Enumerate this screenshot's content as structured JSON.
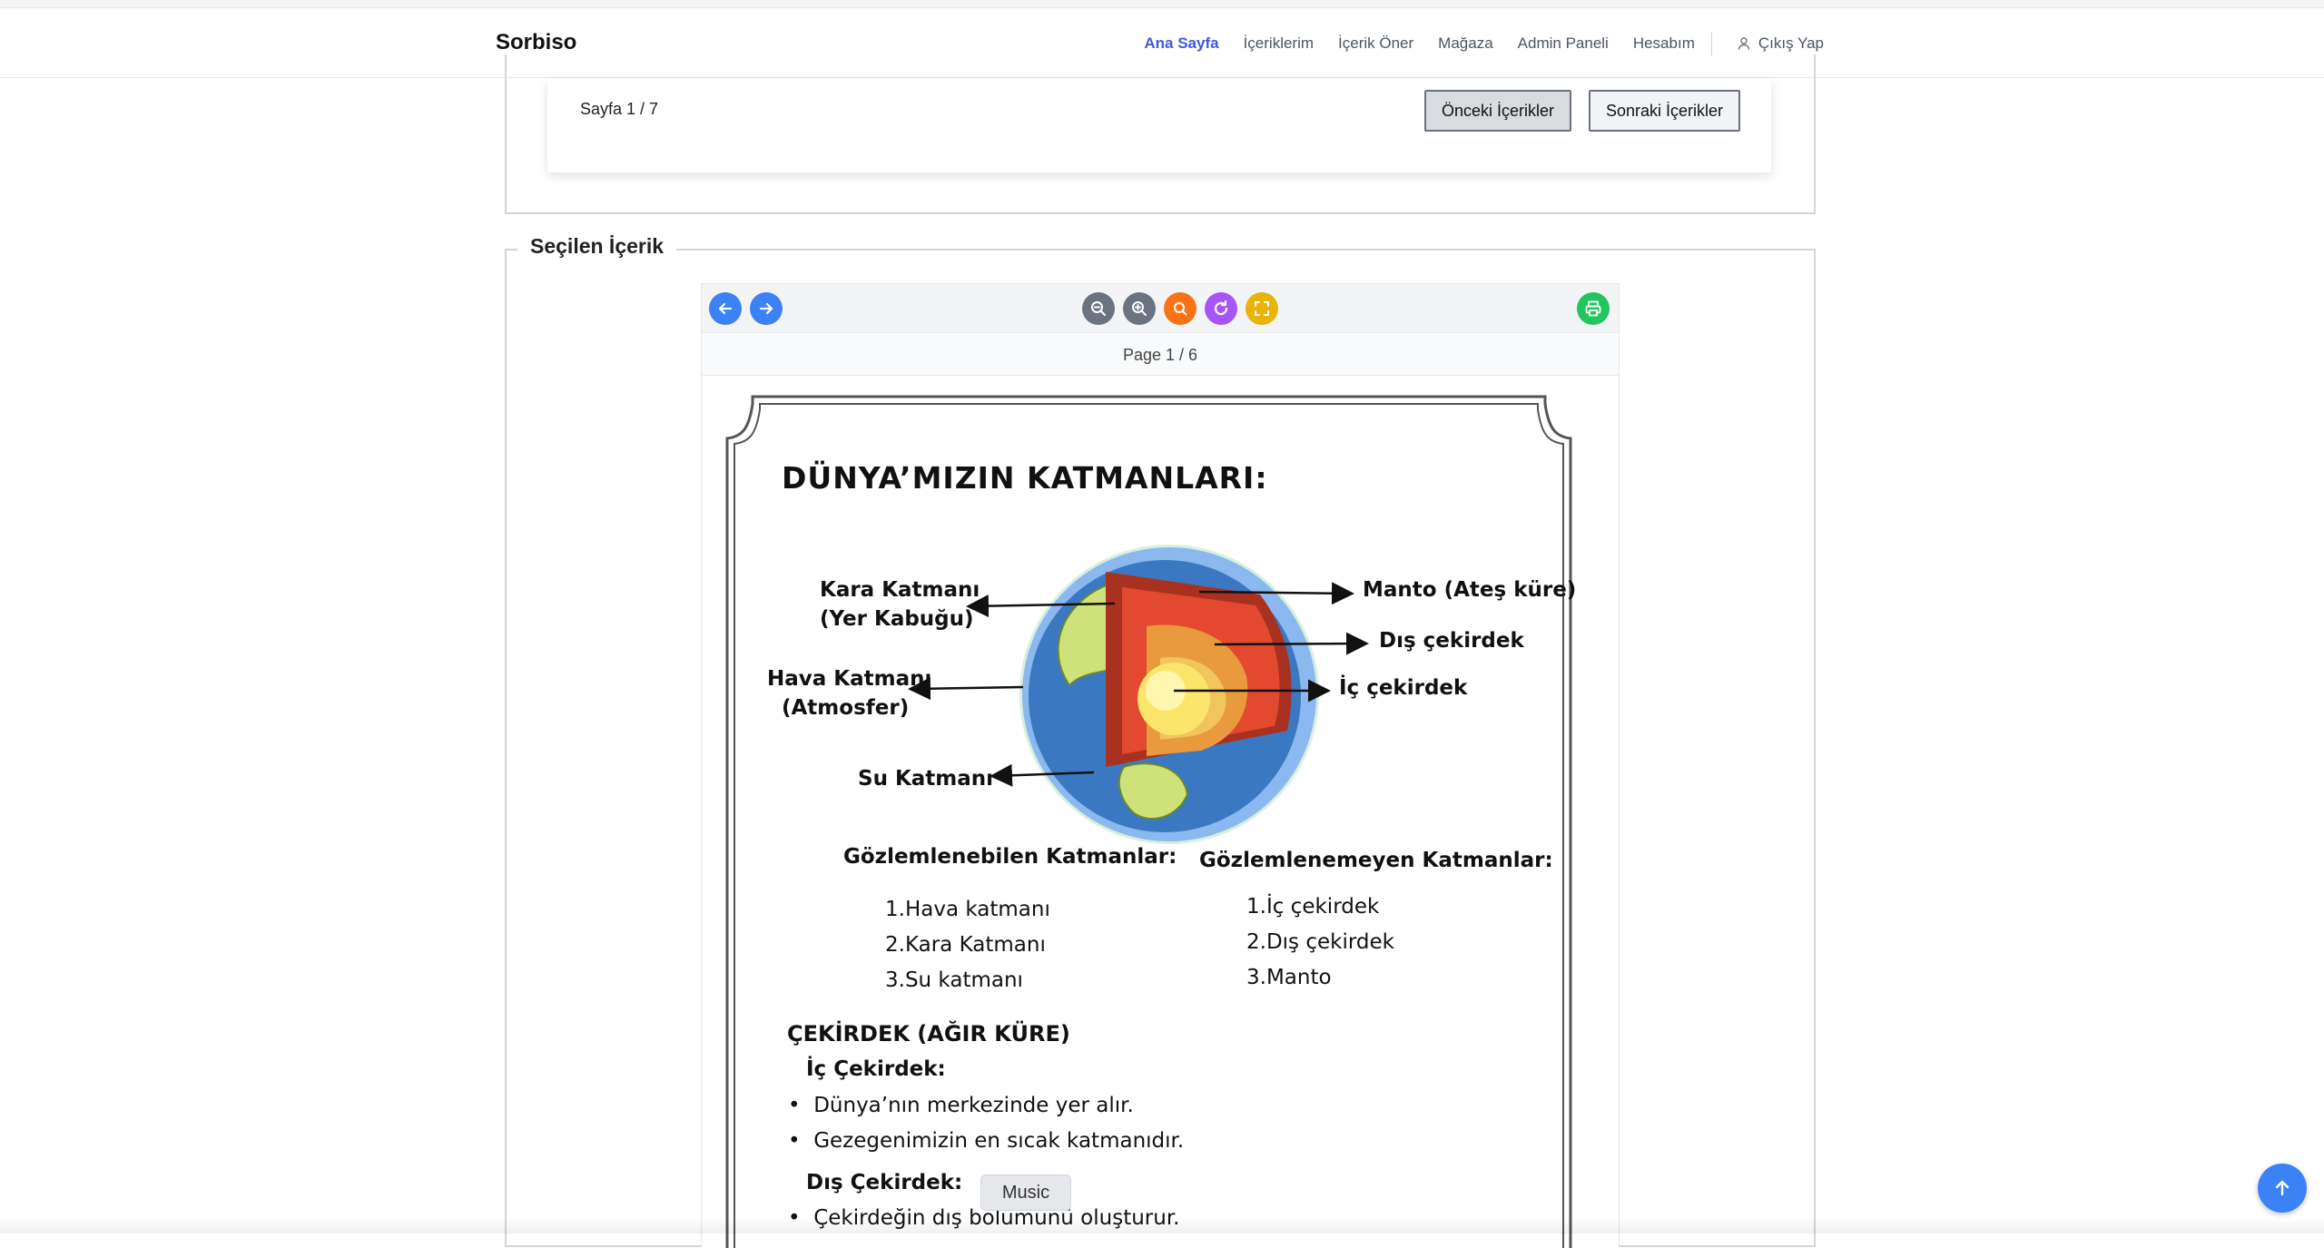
{
  "nav": {
    "brand": "Sorbiso",
    "items": [
      "Ana Sayfa",
      "İçeriklerim",
      "İçerik Öner",
      "Mağaza",
      "Admin Paneli",
      "Hesabım"
    ],
    "active": "Ana Sayfa",
    "logout": "Çıkış Yap"
  },
  "pagination": {
    "page_text": "Sayfa 1 / 7",
    "prev_label": "Önceki İçerikler",
    "next_label": "Sonraki İçerikler"
  },
  "selected": {
    "legend": "Seçilen İçerik"
  },
  "viewer": {
    "page_indicator": "Page 1 / 6",
    "toolbar_icons": [
      "arrow-left-icon",
      "arrow-right-icon",
      "zoom-out-icon",
      "zoom-in-icon",
      "reset-zoom-icon",
      "rotate-icon",
      "fullscreen-icon",
      "print-icon"
    ],
    "colors": {
      "nav": "#3b82f6",
      "zoom": "#6b7280",
      "reset": "#f97316",
      "rotate": "#a855f7",
      "fullscreen": "#eab308",
      "print": "#22c55e"
    }
  },
  "document": {
    "title": "DÜNYA’MIZIN KATMANLARI:",
    "labels": {
      "kara_1": "Kara Katmanı",
      "kara_2": "(Yer Kabuğu)",
      "hava_1": "Hava Katmanı",
      "hava_2": "(Atmosfer)",
      "su": "Su  Katmanı",
      "manto": "Manto (Ateş küre)",
      "dis": "Dış çekirdek",
      "ic": "İç çekirdek"
    },
    "observable_title": "Gözlemlenebilen Katmanlar:",
    "observable": [
      "1.Hava katmanı",
      "2.Kara Katmanı",
      "3.Su katmanı"
    ],
    "unobservable_title": "Gözlemlenemeyen Katmanlar:",
    "unobservable": [
      "1.İç çekirdek",
      "2.Dış çekirdek",
      "3.Manto"
    ],
    "core_heading": "ÇEKİRDEK (AĞIR KÜRE)",
    "inner_heading": "İç Çekirdek:",
    "inner_bullets": [
      "Dünya’nın merkezinde yer alır.",
      "Gezegenimizin en sıcak katmanıdır."
    ],
    "outer_heading": "Dış Çekirdek:",
    "outer_bullets": [
      "Çekirdeğin dış bölümünü oluşturur."
    ]
  },
  "music_label": "Music",
  "brand_color": "#3b5bdb"
}
